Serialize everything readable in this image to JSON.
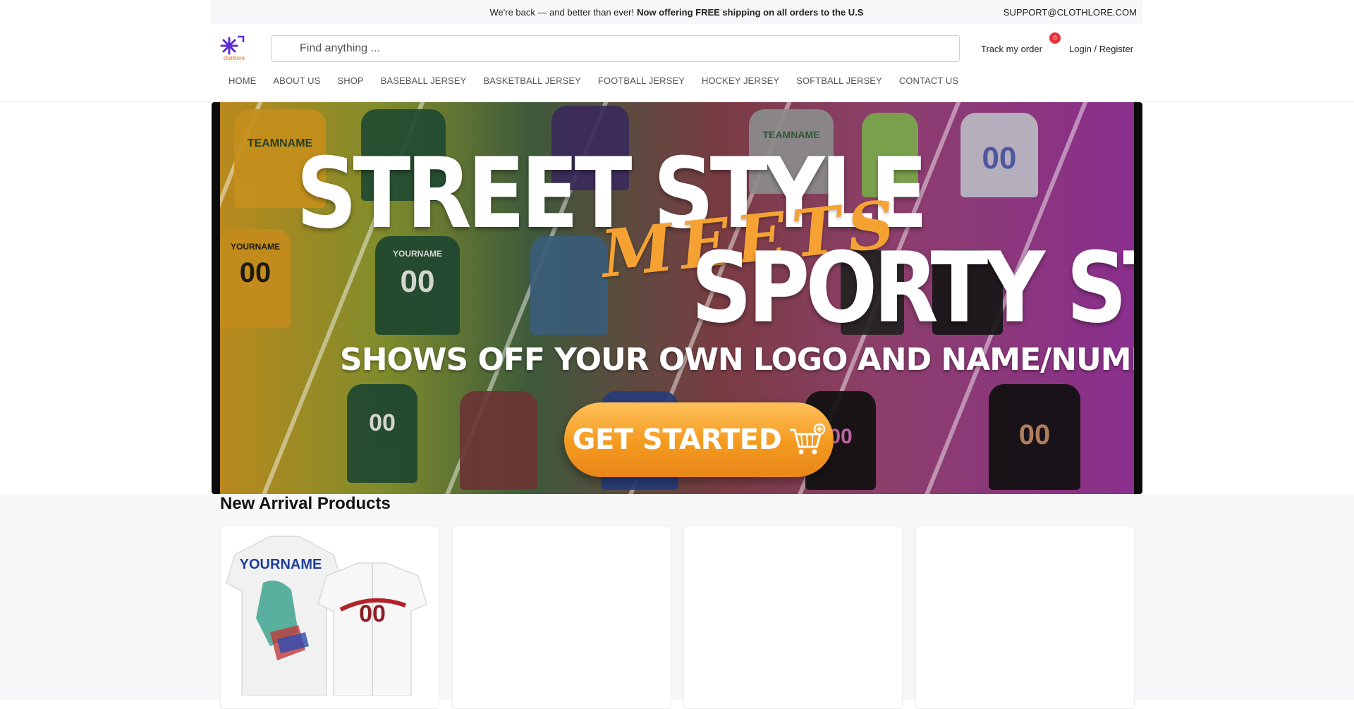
{
  "announcement": {
    "text": "We're back — and better than ever!",
    "highlight": "Now offering FREE shipping on all orders to the U.S",
    "support_email": "SUPPORT@CLOTHLORE.COM"
  },
  "brand": {
    "name": "clothlore"
  },
  "search": {
    "placeholder": "Find anything ...",
    "value": ""
  },
  "header": {
    "track_order_label": "Track my order",
    "cart_count": "0",
    "login_label": "Login / Register"
  },
  "nav": {
    "items": [
      {
        "label": "HOME"
      },
      {
        "label": "ABOUT US"
      },
      {
        "label": "SHOP"
      },
      {
        "label": "BASEBALL JERSEY"
      },
      {
        "label": "BASKETBALL JERSEY"
      },
      {
        "label": "FOOTBALL JERSEY"
      },
      {
        "label": "HOCKEY JERSEY"
      },
      {
        "label": "SOFTBALL JERSEY"
      },
      {
        "label": "CONTACT US"
      }
    ]
  },
  "hero": {
    "line1": "STREET STYLE",
    "script": "MEETS",
    "line2": "SPORTY STYLE",
    "subtitle": "SHOWS OFF  YOUR OWN LOGO AND NAME/NUMBER",
    "cta_label": "GET STARTED",
    "jersey_text": {
      "team_name": "TEAMNAME",
      "your_name": "YOURNAME",
      "number": "00"
    }
  },
  "products": {
    "section_title": "New Arrival Products",
    "cards": [
      {
        "image_text": "YOURNAME",
        "number": "00"
      },
      {},
      {},
      {}
    ]
  },
  "colors": {
    "accent_orange": "#f39a1f",
    "badge_red": "#e8323c",
    "logo_purple": "#5b2bd8"
  }
}
